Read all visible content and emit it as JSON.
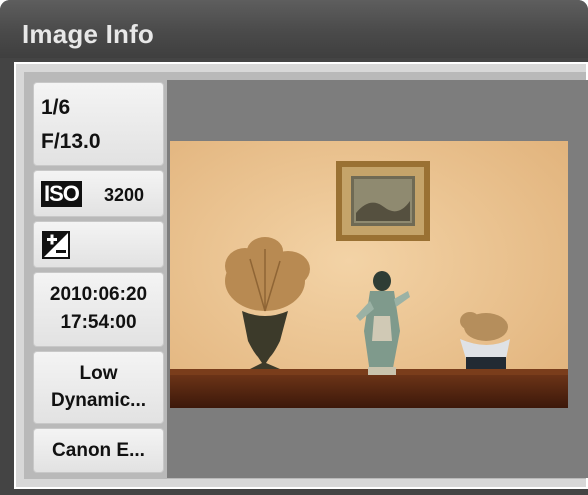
{
  "panel": {
    "title": "Image Info"
  },
  "exposure": {
    "shutter": "1/6",
    "aperture": "F/13.0"
  },
  "iso": {
    "badge": "ISO",
    "value": "3200"
  },
  "exposure_compensation": {
    "icon": "exposure-compensation-icon"
  },
  "capture": {
    "date": "2010:06:20",
    "time": "17:54:00"
  },
  "picture_style": {
    "line1": "Low",
    "line2": "Dynamic..."
  },
  "camera": {
    "model": "Canon E..."
  },
  "thumbnail": {
    "subject": "still-life-photo"
  },
  "colors": {
    "panel_bg": "#444444",
    "wall": "#e9c594",
    "table": "#5a2a14"
  }
}
